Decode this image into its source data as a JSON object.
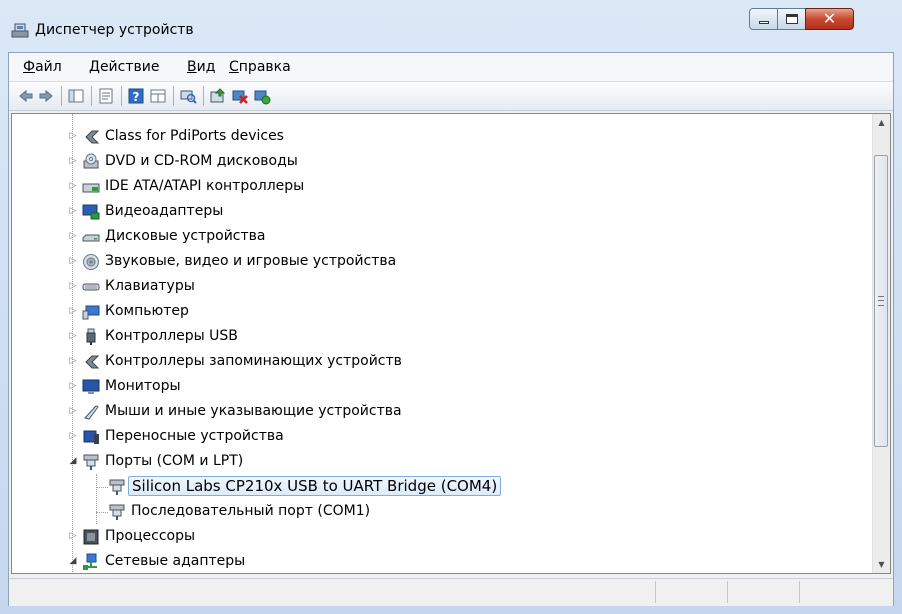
{
  "window": {
    "title": "Диспетчер устройств"
  },
  "menu": [
    {
      "label": "Файл"
    },
    {
      "label": "Действие"
    },
    {
      "label": "Вид"
    },
    {
      "label": "Справка"
    }
  ],
  "toolbar": [
    {
      "icon": "back-icon"
    },
    {
      "icon": "forward-icon"
    },
    {
      "icon": "console-tree-icon"
    },
    {
      "icon": "properties-icon"
    },
    {
      "icon": "help-icon"
    },
    {
      "icon": "view-icon"
    },
    {
      "icon": "scan-hardware-icon"
    },
    {
      "icon": "update-driver-icon"
    },
    {
      "icon": "uninstall-icon"
    },
    {
      "icon": "enable-device-icon"
    }
  ],
  "tree": [
    {
      "label": "Class for PdiPorts devices",
      "icon": "plugin-icon",
      "expander": "collapsed"
    },
    {
      "label": "DVD и CD-ROM дисководы",
      "icon": "dvd-drive-icon",
      "expander": "collapsed"
    },
    {
      "label": "IDE ATA/ATAPI контроллеры",
      "icon": "ide-controller-icon",
      "expander": "collapsed"
    },
    {
      "label": "Видеоадаптеры",
      "icon": "display-adapter-icon",
      "expander": "collapsed"
    },
    {
      "label": "Дисковые устройства",
      "icon": "disk-drive-icon",
      "expander": "collapsed"
    },
    {
      "label": "Звуковые, видео и игровые устройства",
      "icon": "speaker-icon",
      "expander": "collapsed"
    },
    {
      "label": "Клавиатуры",
      "icon": "keyboard-icon",
      "expander": "collapsed"
    },
    {
      "label": "Компьютер",
      "icon": "computer-icon",
      "expander": "collapsed"
    },
    {
      "label": "Контроллеры USB",
      "icon": "usb-icon",
      "expander": "collapsed"
    },
    {
      "label": "Контроллеры запоминающих устройств",
      "icon": "storage-controller-icon",
      "expander": "collapsed"
    },
    {
      "label": "Мониторы",
      "icon": "monitor-icon",
      "expander": "collapsed"
    },
    {
      "label": "Мыши и иные указывающие устройства",
      "icon": "mouse-icon",
      "expander": "collapsed"
    },
    {
      "label": "Переносные устройства",
      "icon": "portable-device-icon",
      "expander": "collapsed"
    },
    {
      "label": "Порты (COM и LPT)",
      "icon": "port-icon",
      "expander": "expanded"
    },
    {
      "label": "Silicon Labs CP210x USB to UART Bridge (COM4)",
      "icon": "port-icon",
      "child": true,
      "selected": true
    },
    {
      "label": "Последовательный порт (COM1)",
      "icon": "port-icon",
      "child": true
    },
    {
      "label": "Процессоры",
      "icon": "processor-icon",
      "expander": "collapsed"
    },
    {
      "label": "Сетевые адаптеры",
      "icon": "network-adapter-icon",
      "expander": "expanded"
    }
  ],
  "colors": {
    "selection_border": "#84acdd",
    "selection_fill": "#dcebfc",
    "close_button": "#c74a2f"
  }
}
